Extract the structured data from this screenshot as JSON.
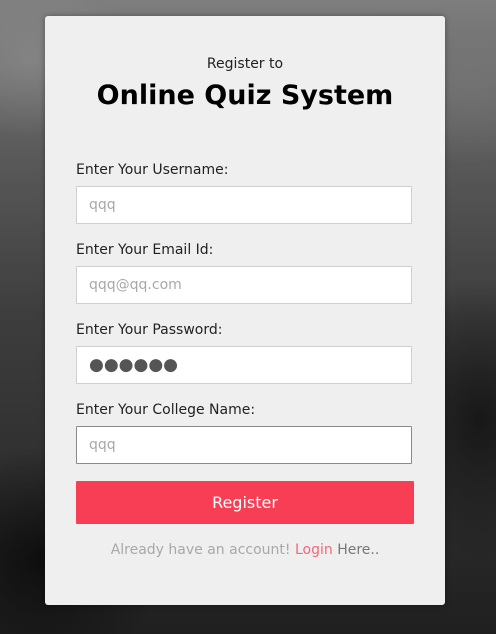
{
  "header": {
    "subtitle": "Register to",
    "title": "Online Quiz System"
  },
  "form": {
    "username": {
      "label": "Enter Your Username:",
      "value": "qqq"
    },
    "email": {
      "label": "Enter Your Email Id:",
      "value": "qqq@qq.com"
    },
    "password": {
      "label": "Enter Your Password:",
      "value": "●●●●●●"
    },
    "college": {
      "label": "Enter Your College Name:",
      "value": "qqq"
    },
    "submit_label": "Register"
  },
  "footer": {
    "prompt": "Already have an account!",
    "link_label": "Login",
    "suffix": "Here.."
  },
  "colors": {
    "accent": "#f73e54",
    "link": "#f0697a",
    "card_bg": "#efefef"
  }
}
